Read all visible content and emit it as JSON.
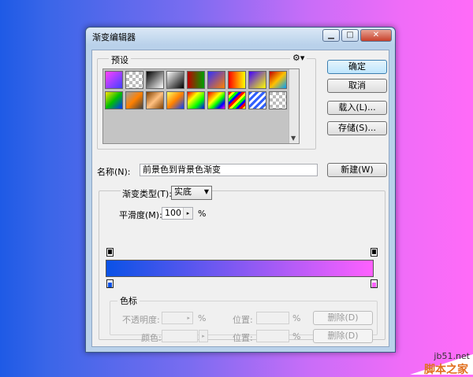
{
  "window": {
    "title": "渐变编辑器"
  },
  "buttons": {
    "ok": "确定",
    "cancel": "取消",
    "load": "载入(L)...",
    "save": "存储(S)...",
    "new": "新建(W)"
  },
  "presets": {
    "label": "预设",
    "gear": "⚙▾",
    "swatches": [
      "linear-gradient(135deg,#ff40ff,#4040ff)",
      "repeating-conic-gradient(#fff 0 25%, #bbb 0 50%) 0 0/8px 8px",
      "linear-gradient(135deg,#000,#fff)",
      "linear-gradient(135deg,#fff,#000)",
      "linear-gradient(90deg,#c00000,#00a000)",
      "linear-gradient(135deg,#3030ff,#ff8000)",
      "linear-gradient(90deg,#ff0000,#ffff00)",
      "linear-gradient(135deg,#4000ff,#ffff00)",
      "linear-gradient(135deg,#c00000,#ffc000,#00a0ff)",
      "linear-gradient(135deg,#ffe000,#00c000,#0030ff)",
      "linear-gradient(135deg,#a0a0a0,#ff8000,#404040)",
      "linear-gradient(135deg,#804000,#ffc080,#804000)",
      "linear-gradient(135deg,#ffff60,#ff8000,#0040ff)",
      "linear-gradient(135deg,#ff0000,#ffff00,#00ff00,#0000ff)",
      "linear-gradient(135deg,#ff0000,#ff8000,#ffff00,#00ff00,#0000ff,#ff00ff)",
      "repeating-linear-gradient(135deg,#ff0000 0 3px,#ffff00 3px 6px,#00ff00 6px 9px,#0000ff 9px 12px)",
      "repeating-linear-gradient(135deg,#3060ff 0 3px,#ffffff 3px 6px)",
      "repeating-conic-gradient(#fff 0 25%, #bbb 0 50%) 0 0/8px 8px"
    ]
  },
  "name": {
    "label": "名称(N):",
    "value": "前景色到背景色渐变"
  },
  "gradient": {
    "type_label": "渐变类型(T):",
    "type_value": "实底",
    "smooth_label": "平滑度(M):",
    "smooth_value": "100",
    "percent": "%",
    "start_color": "#0a52e6",
    "end_color": "#ff60ff"
  },
  "stops": {
    "label": "色标",
    "opacity_label": "不透明度:",
    "opacity_unit": "%",
    "location1_label": "位置:",
    "location1_unit": "%",
    "delete1": "删除(D)",
    "color_label": "颜色:",
    "location2_label": "位置:",
    "location2_unit": "%",
    "delete2": "删除(D)"
  },
  "watermark": {
    "site": "jb51.net",
    "name": "脚本之家"
  }
}
